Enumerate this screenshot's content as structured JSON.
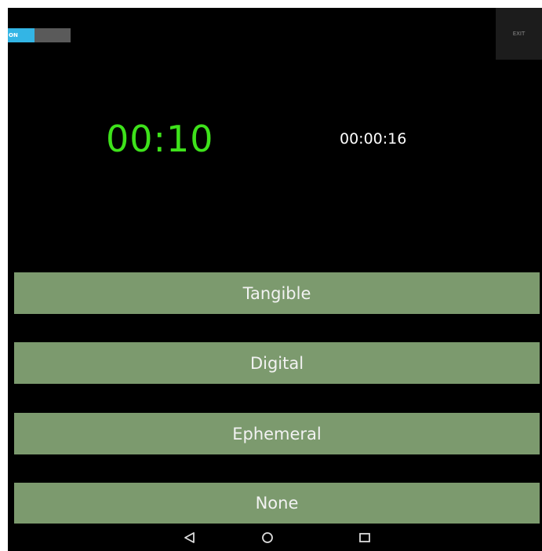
{
  "toggle": {
    "label": "ON",
    "state": "on",
    "on_color": "#33b5e5",
    "off_color": "#5a5a5a"
  },
  "exit": {
    "label": "EXIT"
  },
  "timer": {
    "countdown": "00:10",
    "elapsed": "00:00:16",
    "countdown_color": "#3ee21b"
  },
  "options": [
    {
      "label": "Tangible"
    },
    {
      "label": "Digital"
    },
    {
      "label": "Ephemeral"
    },
    {
      "label": "None"
    }
  ],
  "option_color": "#7c9a6e",
  "navbar": {
    "icons": [
      "back-icon",
      "home-icon",
      "recent-apps-icon"
    ]
  }
}
